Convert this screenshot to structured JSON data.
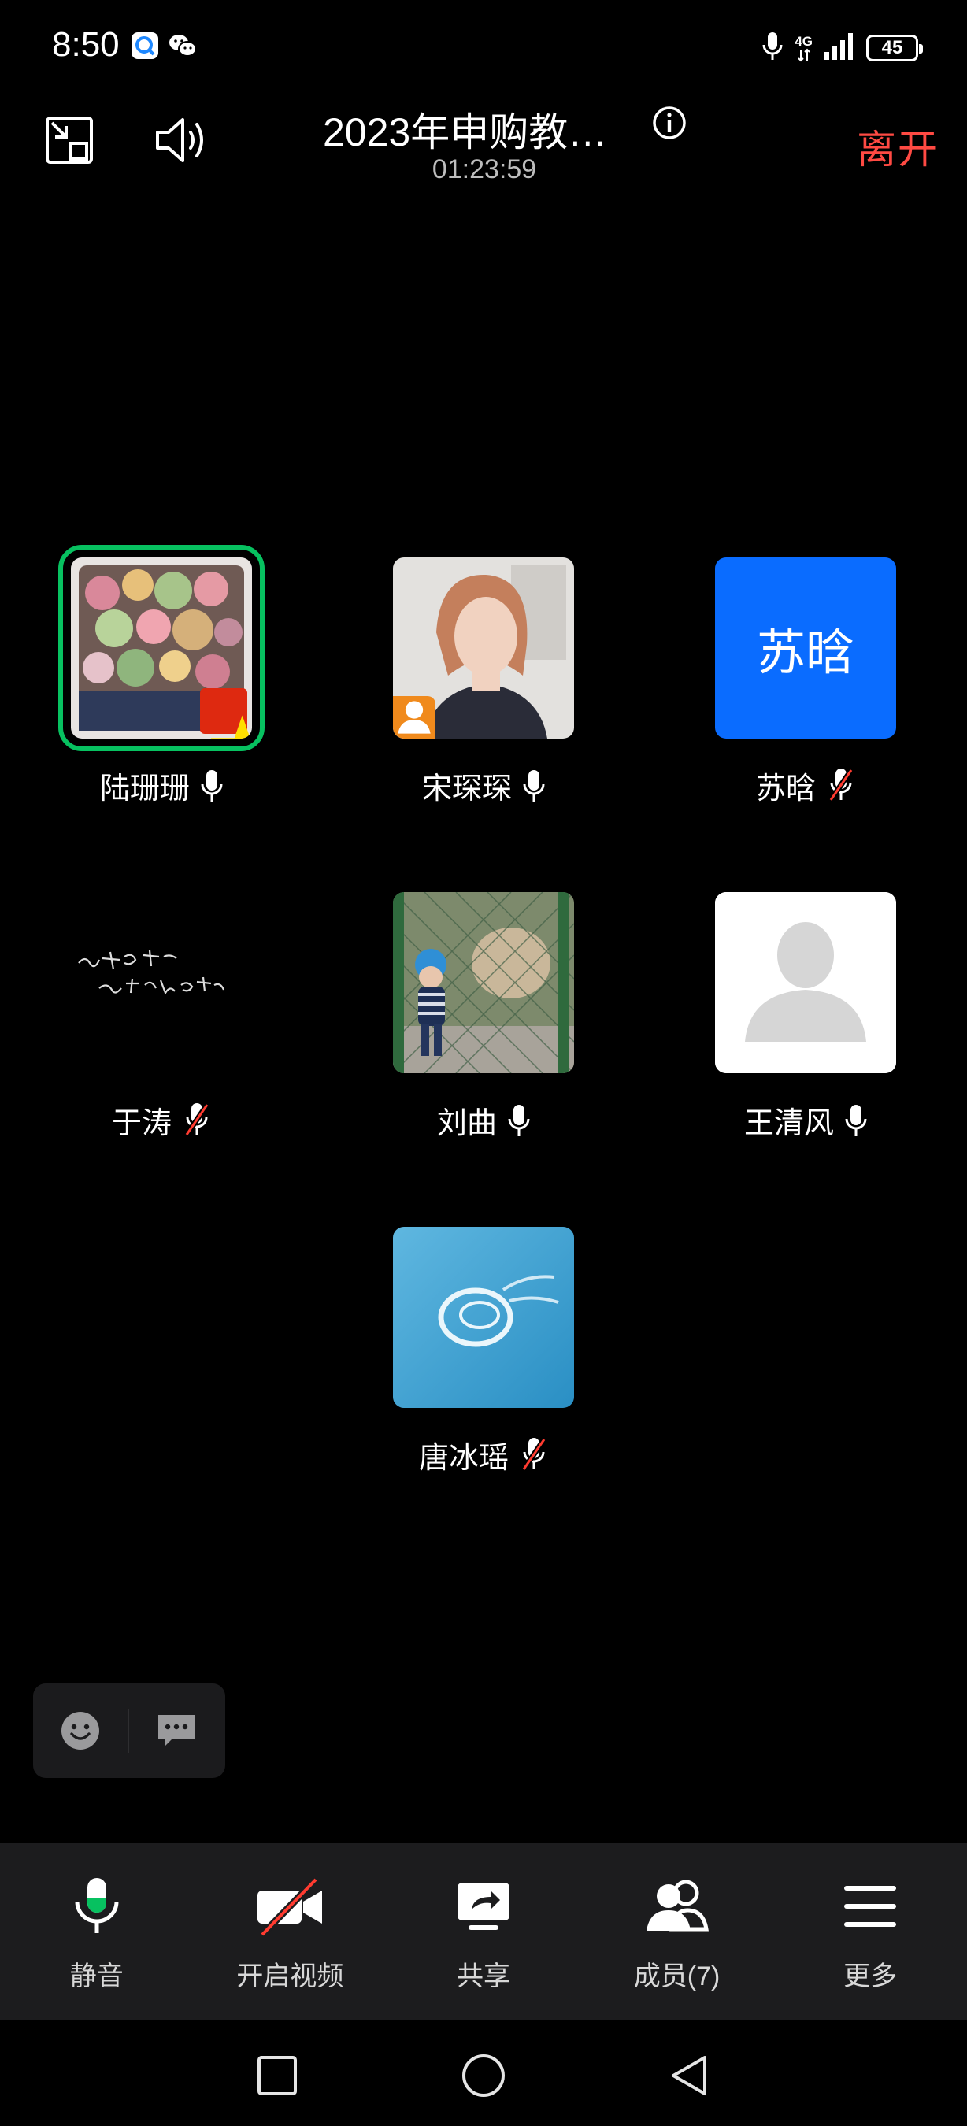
{
  "status_bar": {
    "time": "8:50",
    "network": "4G",
    "battery": "45",
    "icons": [
      "app-notification-icon",
      "wechat-icon",
      "microphone-in-use-icon",
      "cellular-signal-icon",
      "battery-icon"
    ]
  },
  "header": {
    "minimize_icon": "minimize-window-icon",
    "speaker_icon": "speaker-icon",
    "title": "2023年申购教…",
    "duration": "01:23:59",
    "info_icon": "info-icon",
    "leave_label": "离开"
  },
  "participants": [
    {
      "name": "陆珊珊",
      "avatar": "succulents-photo",
      "mic": "on",
      "speaking": true,
      "badge": "china-flag"
    },
    {
      "name": "宋琛琛",
      "avatar": "woman-portrait-photo",
      "mic": "on",
      "speaking": false,
      "badge": "host"
    },
    {
      "name": "苏晗",
      "avatar": "initial",
      "initial": "苏晗",
      "mic": "muted",
      "speaking": false
    },
    {
      "name": "于涛",
      "avatar": "handwriting-image",
      "mic": "muted",
      "speaking": false
    },
    {
      "name": "刘曲",
      "avatar": "child-at-zoo-photo",
      "mic": "on",
      "speaking": false
    },
    {
      "name": "王清风",
      "avatar": "default-avatar",
      "mic": "on",
      "speaking": false
    },
    {
      "name": "唐冰瑶",
      "avatar": "sea-water-photo",
      "mic": "muted",
      "speaking": false
    }
  ],
  "reactions": {
    "emoji_icon": "emoji-icon",
    "chat_icon": "chat-icon"
  },
  "toolbar": {
    "items": [
      {
        "label": "静音",
        "icon": "microphone-icon"
      },
      {
        "label": "开启视频",
        "icon": "video-off-icon"
      },
      {
        "label": "共享",
        "icon": "screen-share-icon"
      },
      {
        "label": "成员(7)",
        "icon": "members-icon"
      },
      {
        "label": "更多",
        "icon": "menu-icon"
      }
    ]
  },
  "colors": {
    "accent_green": "#07c160",
    "leave_red": "#ff4a43",
    "avatar_blue": "#0a6cff",
    "host_orange": "#f08a1c",
    "muted_red": "#ff3b30"
  },
  "navbar": {
    "icons": [
      "recent-apps-icon",
      "home-icon",
      "back-icon"
    ]
  }
}
